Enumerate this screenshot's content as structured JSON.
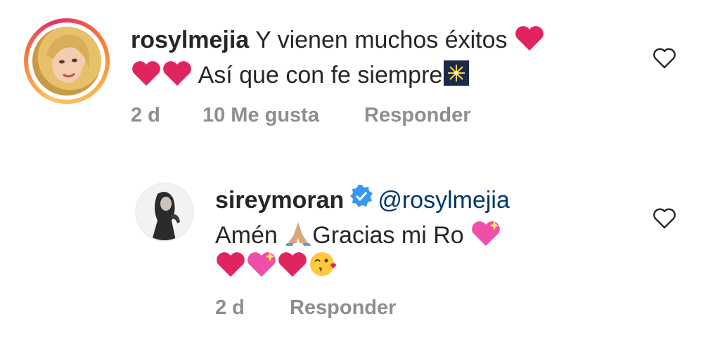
{
  "comments": [
    {
      "username": "rosylmejia",
      "text_part1": "Y vienen muchos éxitos",
      "text_part2": "Así que con fe siempre",
      "age": "2 d",
      "likes": "10 Me gusta",
      "reply_label": "Responder",
      "avatar_icon": "woman-blonde-avatar"
    },
    {
      "username": "sireymoran",
      "verified": true,
      "mention": "@rosylmejia",
      "text_part1": "Amén",
      "text_part2": "Gracias mi Ro",
      "age": "2 d",
      "reply_label": "Responder",
      "avatar_icon": "woman-dark-hair-avatar"
    }
  ],
  "colors": {
    "text": "#262626",
    "meta": "#8e8e8e",
    "mention": "#00376b",
    "verified": "#3897f0",
    "heart": "#e0245e"
  }
}
